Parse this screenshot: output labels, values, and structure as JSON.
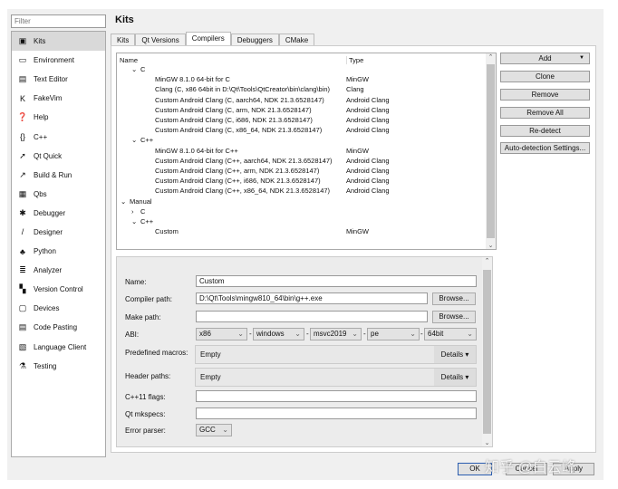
{
  "filter_placeholder": "Filter",
  "sidebar": [
    "Kits",
    "Environment",
    "Text Editor",
    "FakeVim",
    "Help",
    "C++",
    "Qt Quick",
    "Build & Run",
    "Qbs",
    "Debugger",
    "Designer",
    "Python",
    "Analyzer",
    "Version Control",
    "Devices",
    "Code Pasting",
    "Language Client",
    "Testing"
  ],
  "sidebar_icons": [
    "▣",
    "▭",
    "▤",
    "K",
    "❓",
    "{}",
    "➚",
    "↗",
    "▦",
    "✱",
    "/",
    "♣",
    "≣",
    "▚",
    "▢",
    "▤",
    "▧",
    "⚗"
  ],
  "title": "Kits",
  "tabs": [
    "Kits",
    "Qt Versions",
    "Compilers",
    "Debuggers",
    "CMake"
  ],
  "tree": {
    "col_name": "Name",
    "col_type": "Type",
    "rows": [
      {
        "lvl": 1,
        "arrow": "⌄",
        "name": "C",
        "type": ""
      },
      {
        "lvl": 2,
        "name": "MinGW 8.1.0 64-bit for C",
        "type": "MinGW"
      },
      {
        "lvl": 2,
        "name": "Clang (C, x86 64bit in D:\\Qt\\Tools\\QtCreator\\bin\\clang\\bin)",
        "type": "Clang"
      },
      {
        "lvl": 2,
        "name": "Custom Android Clang (C, aarch64, NDK 21.3.6528147)",
        "type": "Android Clang"
      },
      {
        "lvl": 2,
        "name": "Custom Android Clang (C, arm, NDK 21.3.6528147)",
        "type": "Android Clang"
      },
      {
        "lvl": 2,
        "name": "Custom Android Clang (C, i686, NDK 21.3.6528147)",
        "type": "Android Clang"
      },
      {
        "lvl": 2,
        "name": "Custom Android Clang (C, x86_64, NDK 21.3.6528147)",
        "type": "Android Clang"
      },
      {
        "lvl": 1,
        "arrow": "⌄",
        "name": "C++",
        "type": ""
      },
      {
        "lvl": 2,
        "name": "MinGW 8.1.0 64-bit for C++",
        "type": "MinGW"
      },
      {
        "lvl": 2,
        "name": "Custom Android Clang (C++, aarch64, NDK 21.3.6528147)",
        "type": "Android Clang"
      },
      {
        "lvl": 2,
        "name": "Custom Android Clang (C++, arm, NDK 21.3.6528147)",
        "type": "Android Clang"
      },
      {
        "lvl": 2,
        "name": "Custom Android Clang (C++, i686, NDK 21.3.6528147)",
        "type": "Android Clang"
      },
      {
        "lvl": 2,
        "name": "Custom Android Clang (C++, x86_64, NDK 21.3.6528147)",
        "type": "Android Clang"
      },
      {
        "lvl": 0,
        "arrow": "⌄",
        "name": "Manual",
        "type": ""
      },
      {
        "lvl": 1,
        "arrow": "›",
        "name": "C",
        "type": ""
      },
      {
        "lvl": 1,
        "arrow": "⌄",
        "name": "C++",
        "type": ""
      },
      {
        "lvl": 2,
        "name": "Custom",
        "type": "MinGW"
      }
    ]
  },
  "buttons": {
    "add": "Add",
    "clone": "Clone",
    "remove": "Remove",
    "remove_all": "Remove All",
    "redetect": "Re-detect",
    "auto": "Auto-detection Settings..."
  },
  "form": {
    "name_label": "Name:",
    "name": "Custom",
    "compiler_label": "Compiler path:",
    "compiler": "D:\\Qt\\Tools\\mingw810_64\\bin\\g++.exe",
    "make_label": "Make path:",
    "make": "",
    "browse": "Browse...",
    "abi_label": "ABI:",
    "abi": [
      "x86",
      "windows",
      "msvc2019",
      "pe",
      "64bit"
    ],
    "macros_label": "Predefined macros:",
    "headers_label": "Header paths:",
    "empty": "Empty",
    "details": "Details ▾",
    "flags_label": "C++11 flags:",
    "mkspecs_label": "Qt mkspecs:",
    "parser_label": "Error parser:",
    "parser": "GCC"
  },
  "footer": {
    "ok": "OK",
    "cancel": "Cancel",
    "apply": "Apply"
  },
  "watermark": "知乎 @白云峰"
}
